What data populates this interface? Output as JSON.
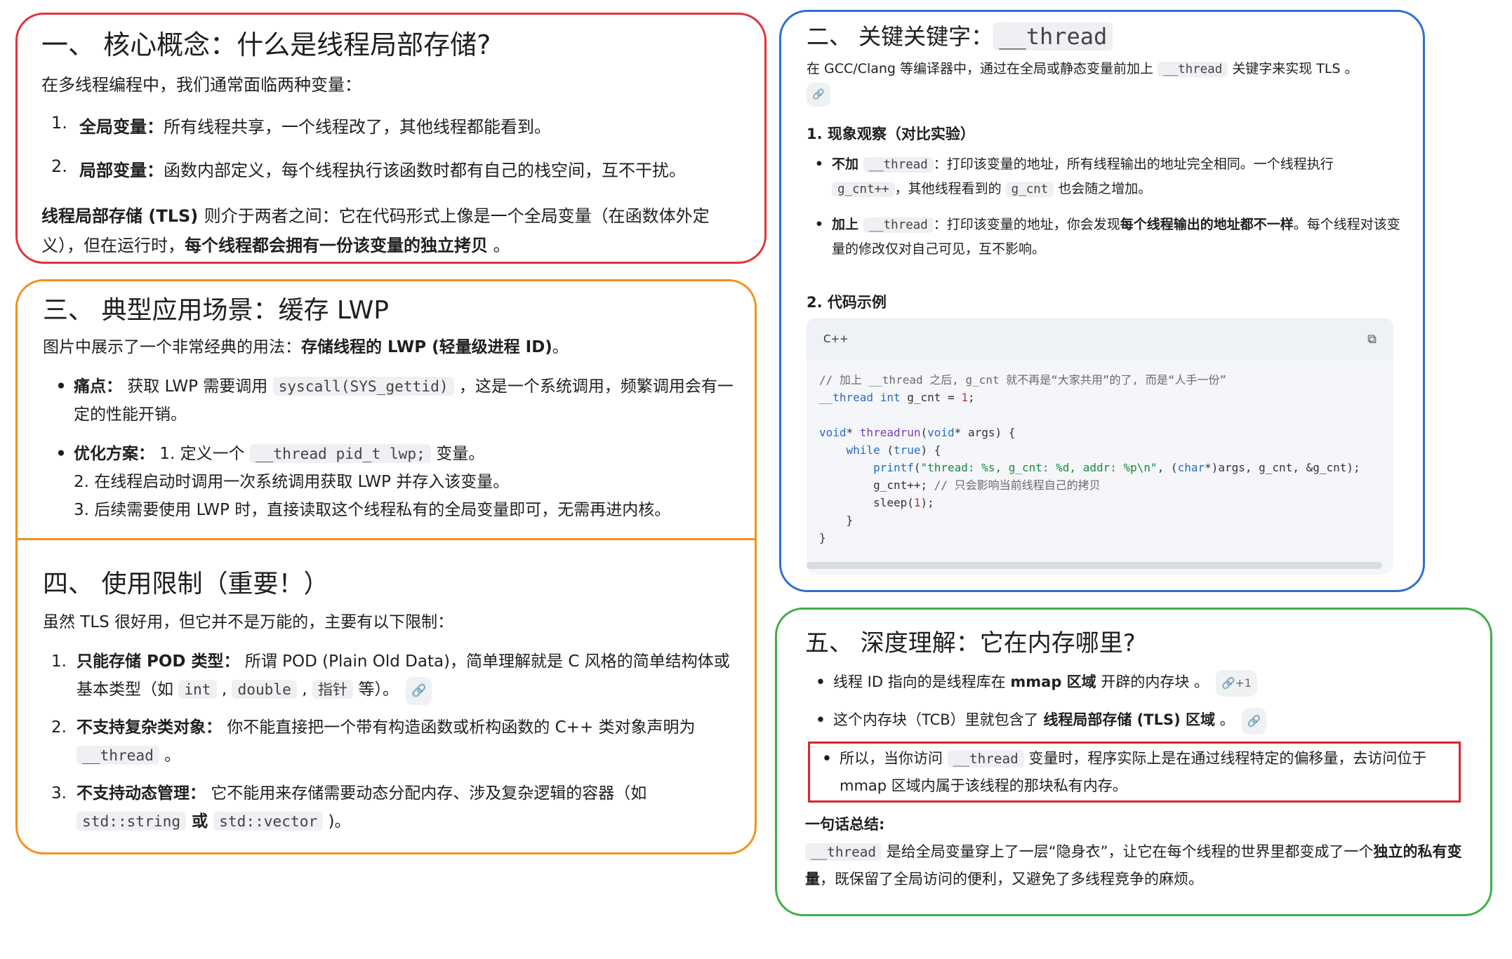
{
  "s1": {
    "title": "一、 核心概念：什么是线程局部存储?",
    "intro": "在多线程编程中，我们通常面临两种变量：",
    "items": [
      {
        "n": "1.",
        "label": "全局变量：",
        "text": "所有线程共享，一个线程改了，其他线程都能看到。"
      },
      {
        "n": "2.",
        "label": "局部变量：",
        "text": "函数内部定义，每个线程执行该函数时都有自己的栈空间，互不干扰。"
      }
    ],
    "summary_label": "线程局部存储 (TLS) ",
    "summary_text": "则介于两者之间：它在代码形式上像是一个全局变量（在函数体外定义），但在运行时，",
    "summary_bold": "每个线程都会拥有一份该变量的独立拷贝",
    "summary_end": " 。"
  },
  "s2": {
    "title": "二、 关键关键字：",
    "title_code": "__thread",
    "intro_a": "在 GCC/Clang 等编译器中，通过在全局或静态变量前加上 ",
    "intro_code": "__thread",
    "intro_b": " 关键字来实现 TLS 。",
    "h1": "1. 现象观察（对比实验）",
    "b1_label": "不加 ",
    "b1_code": "__thread",
    "b1_a": "：打印该变量的地址，所有线程输出的地址完全相同。一个线程执行 ",
    "b1_code2": "g_cnt++",
    "b1_b": "，其他线程看到的 ",
    "b1_code3": "g_cnt",
    "b1_c": " 也会随之增加。",
    "b2_label": "加上 ",
    "b2_code": "__thread",
    "b2_a": "：打印该变量的地址，你会发现",
    "b2_bold": "每个线程输出的地址都不一样",
    "b2_b": "。每个线程对该变量的修改仅对自己可见，互不影响。",
    "h2": "2. 代码示例",
    "lang": "C++",
    "code": {
      "l1": "// 加上 __thread 之后, g_cnt 就不再是“大家共用”的了, 而是“人手一份”",
      "l2a": "__thread ",
      "l2b": "int",
      "l2c": " g_cnt = ",
      "l2d": "1",
      "l2e": ";",
      "l4a": "void",
      "l4b": "* ",
      "l4c": "threadrun",
      "l4d": "(",
      "l4e": "void",
      "l4f": "* args) {",
      "l5a": "    ",
      "l5b": "while",
      "l5c": " (",
      "l5d": "true",
      "l5e": ") {",
      "l6a": "        ",
      "l6b": "printf",
      "l6c": "(",
      "l6d": "\"thread: %s, g_cnt: %d, addr: %p\\n\"",
      "l6e": ", (",
      "l6f": "char",
      "l6g": "*)args, g_cnt, &g_cnt);",
      "l7a": "        g_cnt++; ",
      "l7b": "// 只会影响当前线程自己的拷贝",
      "l8a": "        sleep(",
      "l8b": "1",
      "l8c": ");",
      "l9": "    }",
      "l10": "}"
    }
  },
  "s3": {
    "title": "三、 典型应用场景：缓存 LWP",
    "intro_a": "图片中展示了一个非常经典的用法：",
    "intro_bold": "存储线程的 LWP (轻量级进程 ID)",
    "intro_end": "。",
    "b1_label": "痛点：",
    "b1_a": " 获取 LWP 需要调用 ",
    "b1_code": "syscall(SYS_gettid)",
    "b1_b": " ，这是一个系统调用，频繁调用会有一定的性能开销。",
    "b2_label": "优化方案：",
    "b2_a": " 1. 定义一个 ",
    "b2_code": "__thread pid_t lwp;",
    "b2_b": " 变量。",
    "b2_l2": "2. 在线程启动时调用一次系统调用获取 LWP 并存入该变量。",
    "b2_l3": "3. 后续需要使用 LWP 时，直接读取这个线程私有的全局变量即可，无需再进内核。"
  },
  "s4": {
    "title": "四、 使用限制（重要！）",
    "intro": "虽然 TLS 很好用，但它并不是万能的，主要有以下限制：",
    "i1_n": "1.",
    "i1_label": "只能存储 POD 类型：",
    "i1_a": " 所谓 POD (Plain Old Data)，简单理解就是 C 风格的简单结构体或基本类型（如 ",
    "i1_c1": "int",
    "i1_sep": " , ",
    "i1_c2": "double",
    "i1_c3": "指针",
    "i1_b": " 等）。",
    "i2_n": "2.",
    "i2_label": "不支持复杂类对象：",
    "i2_a": " 你不能直接把一个带有构造函数或析构函数的 C++ 类对象声明为 ",
    "i2_code": "__thread",
    "i2_b": " 。",
    "i3_n": "3.",
    "i3_label": "不支持动态管理：",
    "i3_a": " 它不能用来存储需要动态分配内存、涉及复杂逻辑的容器（如 ",
    "i3_c1": "std::string",
    "i3_or": " 或 ",
    "i3_c2": "std::vector",
    "i3_b": " )。"
  },
  "s5": {
    "title": "五、 深度理解：它在内存哪里?",
    "b1_a": "线程 ID 指向的是线程库在 ",
    "b1_bold": "mmap 区域",
    "b1_b": " 开辟的内存块 。",
    "b1_badge": "+1",
    "b2_a": "这个内存块（TCB）里就包含了 ",
    "b2_bold": "线程局部存储 (TLS) 区域",
    "b2_b": " 。",
    "b3_a": "所以，当你访问 ",
    "b3_code": "__thread",
    "b3_b": " 变量时，程序实际上是在通过线程特定的偏移量，去访问位于 mmap 区域内属于该线程的那块私有内存。",
    "sum_label": "一句话总结:",
    "sum_code": "__thread",
    "sum_a": " 是给全局变量穿上了一层“隐身衣”，让它在每个线程的世界里都变成了一个",
    "sum_bold": "独立的私有变量",
    "sum_b": "，既保留了全局访问的便利，又避免了多线程竞争的麻烦。"
  }
}
